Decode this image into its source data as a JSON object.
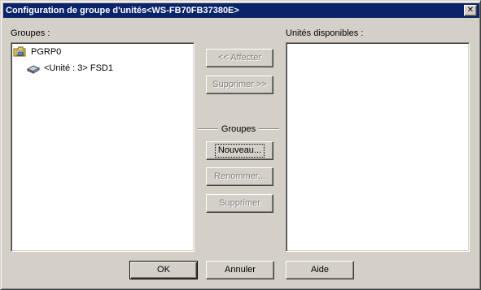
{
  "window": {
    "title": "Configuration de groupe d'unités<WS-FB70FB37380E>",
    "close_glyph": "✕"
  },
  "left": {
    "label": "Groupes :",
    "tree": [
      {
        "label": "PGRP0",
        "icon": "group-folder-icon"
      },
      {
        "label": "<Unité :  3> FSD1",
        "icon": "drive-icon"
      }
    ]
  },
  "right": {
    "label": "Unités disponibles :"
  },
  "middle": {
    "assign_label": "<< Affecter",
    "remove_label": "Supprimer >>",
    "group_title": "Groupes",
    "new_label": "Nouveau...",
    "rename_label": "Renommer...",
    "delete_label": "Supprimer"
  },
  "footer": {
    "ok_label": "OK",
    "cancel_label": "Annuler",
    "help_label": "Aide"
  },
  "colors": {
    "titlebar": "#0a246a",
    "face": "#d4d0c8"
  }
}
